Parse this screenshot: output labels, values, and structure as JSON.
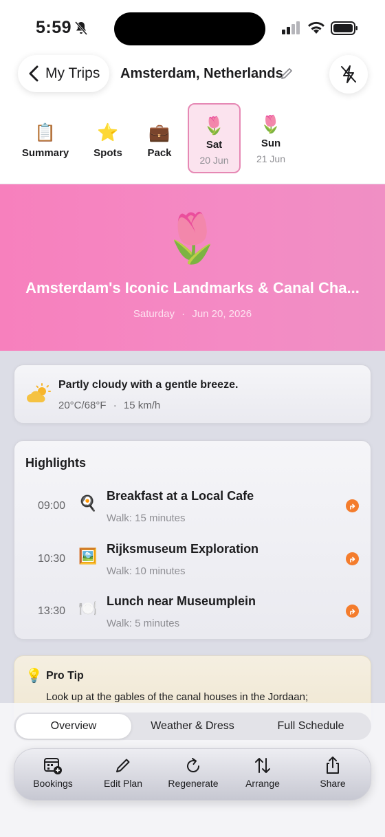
{
  "status_bar": {
    "time": "5:59"
  },
  "header": {
    "back_label": "My Trips",
    "trip_title": "Amsterdam, Netherlands"
  },
  "tabs": [
    {
      "emoji": "📋",
      "label": "Summary"
    },
    {
      "emoji": "⭐",
      "label": "Spots"
    },
    {
      "emoji": "💼",
      "label": "Pack"
    },
    {
      "emoji": "🌷",
      "label": "Sat",
      "sub": "20 Jun",
      "selected": true
    },
    {
      "emoji": "🌷",
      "label": "Sun",
      "sub": "21 Jun"
    }
  ],
  "hero": {
    "emoji": "🌷",
    "title": "Amsterdam's Iconic Landmarks & Canal Cha...",
    "weekday": "Saturday",
    "separator": "·",
    "date": "Jun 20, 2026",
    "bg_color": "#f780bd"
  },
  "weather": {
    "summary": "Partly cloudy with a gentle breeze.",
    "temperature": "20°C/68°F",
    "separator": "·",
    "wind": "15 km/h"
  },
  "highlights": {
    "title": "Highlights",
    "items": [
      {
        "time": "09:00",
        "emoji": "🍳",
        "title": "Breakfast at a Local Cafe",
        "sub": "Walk: 15 minutes"
      },
      {
        "time": "10:30",
        "emoji": "🖼️",
        "title": "Rijksmuseum Exploration",
        "sub": "Walk: 10 minutes"
      },
      {
        "time": "13:30",
        "emoji": "🍽️",
        "title": "Lunch near Museumplein",
        "sub": "Walk: 5 minutes"
      }
    ],
    "accent_color": "#f47c2c"
  },
  "tip": {
    "icon": "💡",
    "title": "Pro Tip",
    "text": "Look up at the gables of the canal houses in the Jordaan;"
  },
  "segments": {
    "items": [
      "Overview",
      "Weather & Dress",
      "Full Schedule"
    ],
    "selected": "Overview"
  },
  "toolbar": {
    "items": [
      {
        "icon": "calendar-plus-icon",
        "label": "Bookings"
      },
      {
        "icon": "pencil-icon",
        "label": "Edit Plan"
      },
      {
        "icon": "refresh-icon",
        "label": "Regenerate"
      },
      {
        "icon": "sort-arrows-icon",
        "label": "Arrange"
      },
      {
        "icon": "share-icon",
        "label": "Share"
      }
    ]
  }
}
